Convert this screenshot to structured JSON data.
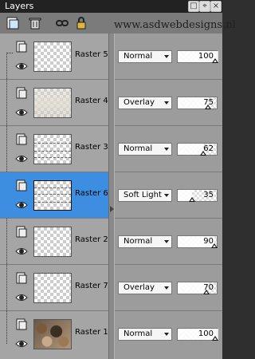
{
  "window": {
    "title": "Layers"
  },
  "toolbar": {
    "buttons": [
      {
        "name": "new-layer-icon"
      },
      {
        "name": "delete-icon"
      },
      {
        "name": "link-icon"
      },
      {
        "name": "lock-icon"
      }
    ],
    "watermark": "www.asdwebdesigns.nl"
  },
  "layers": [
    {
      "name": "Raster 5",
      "blend": "Normal",
      "opacity": "100",
      "opacity_value": 100,
      "selected": false
    },
    {
      "name": "Raster 4",
      "blend": "Overlay",
      "opacity": "75",
      "opacity_value": 75,
      "selected": false
    },
    {
      "name": "Raster 3",
      "blend": "Normal",
      "opacity": "62",
      "opacity_value": 62,
      "selected": false
    },
    {
      "name": "Raster 6",
      "blend": "Soft Light",
      "opacity": "35",
      "opacity_value": 35,
      "selected": true
    },
    {
      "name": "Raster 2",
      "blend": "Normal",
      "opacity": "90",
      "opacity_value": 90,
      "selected": false
    },
    {
      "name": "Raster 7",
      "blend": "Overlay",
      "opacity": "70",
      "opacity_value": 70,
      "selected": false
    },
    {
      "name": "Raster 1",
      "blend": "Normal",
      "opacity": "100",
      "opacity_value": 100,
      "selected": false
    }
  ],
  "colors": {
    "selected": "#3d8ee0",
    "panel": "#9c9c9c",
    "titlebar": "#222222"
  }
}
